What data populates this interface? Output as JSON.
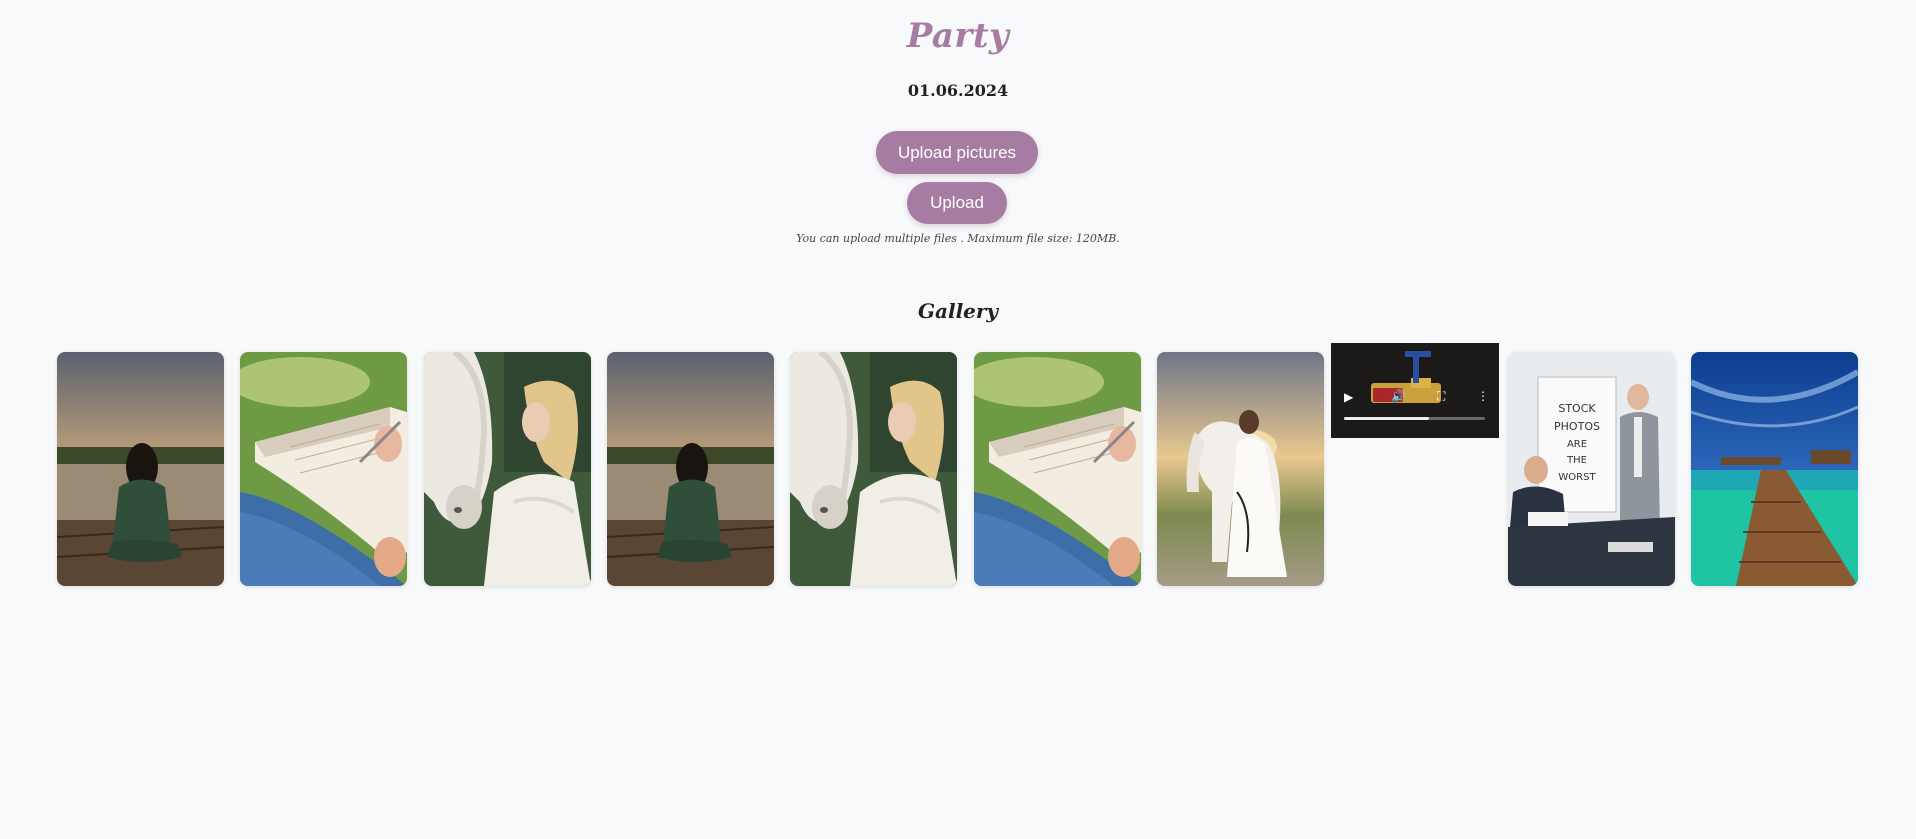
{
  "event": {
    "title": "Party",
    "date": "01.06.2024"
  },
  "actions": {
    "upload_pictures_label": "Upload pictures",
    "upload_label": "Upload",
    "hint": "You can upload multiple files . Maximum file size: 120MB."
  },
  "gallery": {
    "title": "Gallery",
    "items": [
      {
        "type": "image",
        "subject": "woman-meditating-dock"
      },
      {
        "type": "image",
        "subject": "hand-writing-notebook"
      },
      {
        "type": "image",
        "subject": "woman-with-white-horse"
      },
      {
        "type": "image",
        "subject": "woman-meditating-dock"
      },
      {
        "type": "image",
        "subject": "woman-with-white-horse"
      },
      {
        "type": "image",
        "subject": "hand-writing-notebook"
      },
      {
        "type": "image",
        "subject": "bride-with-white-horse"
      },
      {
        "type": "video",
        "subject": "lego-video",
        "controls": [
          "play-icon",
          "volume-icon",
          "fullscreen-icon",
          "more-options-icon"
        ]
      },
      {
        "type": "image",
        "subject": "business-presentation",
        "whiteboard_text": [
          "STOCK",
          "PHOTOS",
          "ARE",
          "THE",
          "WORST"
        ]
      },
      {
        "type": "image",
        "subject": "tropical-boardwalk"
      }
    ]
  },
  "colors": {
    "accent": "#a67ca3",
    "background": "#f8f9fa",
    "text": "#222222"
  }
}
